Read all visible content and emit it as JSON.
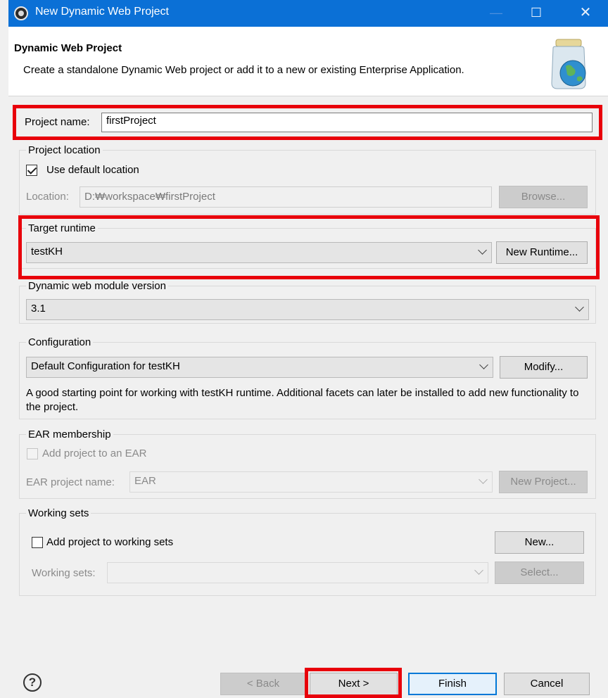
{
  "window": {
    "title": "New Dynamic Web Project",
    "minimize_glyph": "—",
    "maximize_glyph": "☐",
    "close_glyph": "✕"
  },
  "header": {
    "title": "Dynamic Web Project",
    "description": "Create a standalone Dynamic Web project or add it to a new or existing Enterprise Application."
  },
  "project_name": {
    "label": "Project name:",
    "value": "firstProject"
  },
  "project_location": {
    "group_label": "Project location",
    "use_default_label": "Use default location",
    "use_default_checked": true,
    "location_label": "Location:",
    "location_value": "D:₩workspace₩firstProject",
    "browse_label": "Browse..."
  },
  "target_runtime": {
    "group_label": "Target runtime",
    "selected": "testKH",
    "new_runtime_label": "New Runtime..."
  },
  "module_version": {
    "group_label": "Dynamic web module version",
    "selected": "3.1"
  },
  "configuration": {
    "group_label": "Configuration",
    "selected": "Default Configuration for testKH",
    "modify_label": "Modify...",
    "description": "A good starting point for working with testKH runtime. Additional facets can later be installed to add new functionality to the project."
  },
  "ear": {
    "group_label": "EAR membership",
    "add_label": "Add project to an EAR",
    "add_checked": false,
    "name_label": "EAR project name:",
    "name_value": "EAR",
    "new_project_label": "New Project..."
  },
  "working_sets": {
    "group_label": "Working sets",
    "add_label": "Add project to working sets",
    "add_checked": false,
    "new_label": "New...",
    "sets_label": "Working sets:",
    "select_label": "Select..."
  },
  "footer": {
    "help_glyph": "?",
    "back_label": "< Back",
    "next_label": "Next >",
    "finish_label": "Finish",
    "cancel_label": "Cancel"
  },
  "colors": {
    "titlebar": "#0b70d6",
    "highlight": "#e8000b",
    "primary_border": "#0078d7"
  }
}
